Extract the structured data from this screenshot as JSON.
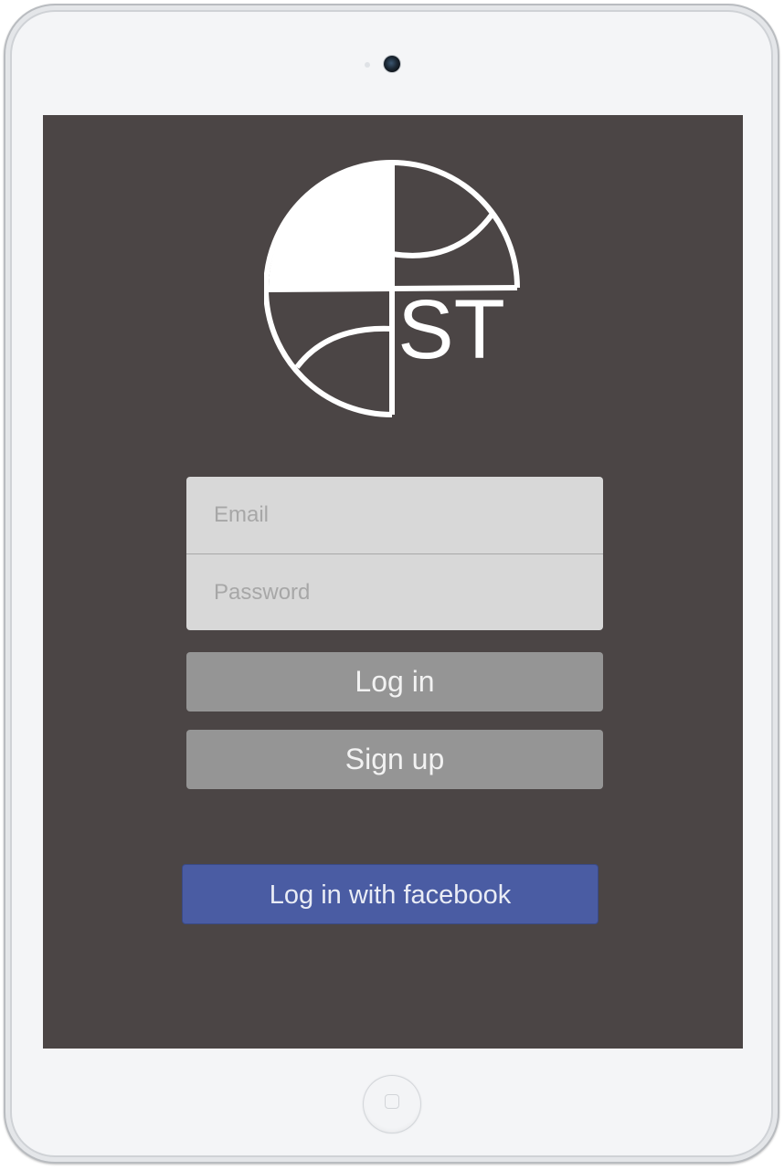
{
  "logo": {
    "text": "ST",
    "color": "#ffffff"
  },
  "login_form": {
    "email_placeholder": "Email",
    "password_placeholder": "Password"
  },
  "buttons": {
    "login_label": "Log in",
    "signup_label": "Sign up",
    "facebook_label": "Log in with facebook"
  },
  "colors": {
    "screen_background": "#4b4545",
    "field_background": "#d8d8d8",
    "button_background": "#959595",
    "facebook_blue": "#4a5ca3"
  }
}
